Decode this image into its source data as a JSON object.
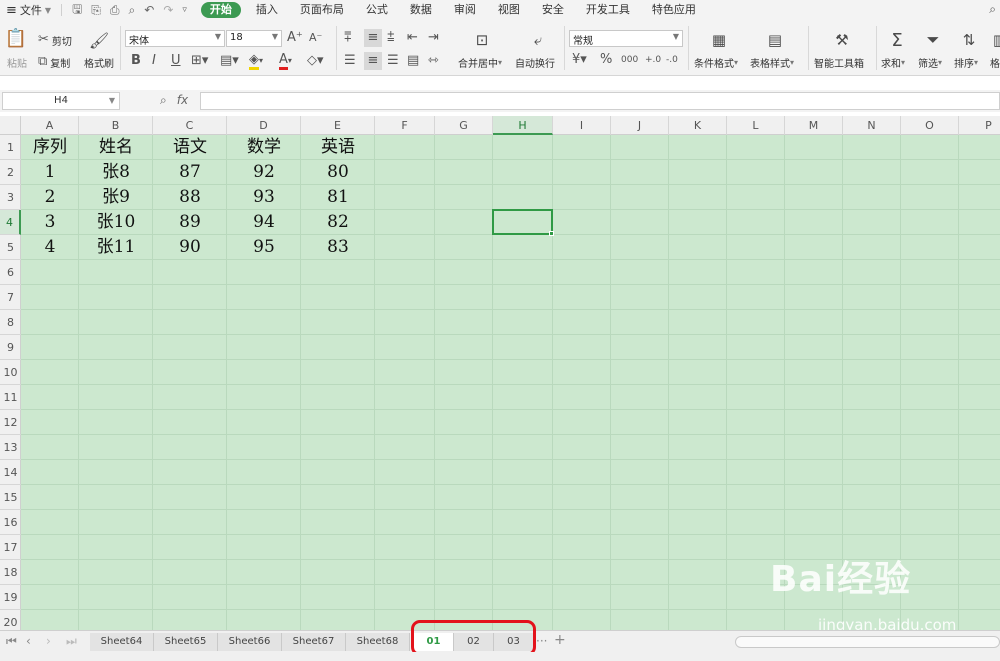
{
  "menu": {
    "file": "文件",
    "tabs": [
      "开始",
      "插入",
      "页面布局",
      "公式",
      "数据",
      "审阅",
      "视图",
      "安全",
      "开发工具",
      "特色应用"
    ],
    "active_tab": "开始"
  },
  "ribbon": {
    "paste": "粘贴",
    "cut": "剪切",
    "copy": "复制",
    "format_painter": "格式刷",
    "font_name": "宋体",
    "font_size": "18",
    "bold": "B",
    "italic": "I",
    "underline": "U",
    "merge_center": "合并居中",
    "wrap_text": "自动换行",
    "number_format": "常规",
    "conditional_format": "条件格式",
    "table_style": "表格样式",
    "smart_toolbox": "智能工具箱",
    "sum": "求和",
    "filter": "筛选",
    "sort": "排序",
    "format": "格式"
  },
  "formula_bar": {
    "cell_ref": "H4",
    "fx": "fx",
    "value": ""
  },
  "grid": {
    "columns": [
      "A",
      "B",
      "C",
      "D",
      "E",
      "F",
      "G",
      "H",
      "I",
      "J",
      "K",
      "L",
      "M",
      "N",
      "O",
      "P"
    ],
    "rows": [
      "1",
      "2",
      "3",
      "4",
      "5",
      "6",
      "7",
      "8",
      "9",
      "10",
      "11",
      "12",
      "13",
      "14",
      "15",
      "16",
      "17",
      "18",
      "19",
      "20"
    ],
    "selected_column": "H",
    "selected_row": "4",
    "data": [
      [
        "序列",
        "姓名",
        "语文",
        "数学",
        "英语"
      ],
      [
        "1",
        "张8",
        "87",
        "92",
        "80"
      ],
      [
        "2",
        "张9",
        "88",
        "93",
        "81"
      ],
      [
        "3",
        "张10",
        "89",
        "94",
        "82"
      ],
      [
        "4",
        "张11",
        "90",
        "95",
        "83"
      ]
    ]
  },
  "sheets": {
    "tabs": [
      "Sheet64",
      "Sheet65",
      "Sheet66",
      "Sheet67",
      "Sheet68",
      "01",
      "02",
      "03"
    ],
    "active": "01",
    "more": "···",
    "add": "+"
  },
  "watermark": {
    "brand": "Bai经验",
    "url": "jingyan.baidu.com"
  },
  "colors": {
    "accent": "#3c9a52",
    "grid_bg": "#cce8cf",
    "highlight_ring": "#e3121b"
  }
}
